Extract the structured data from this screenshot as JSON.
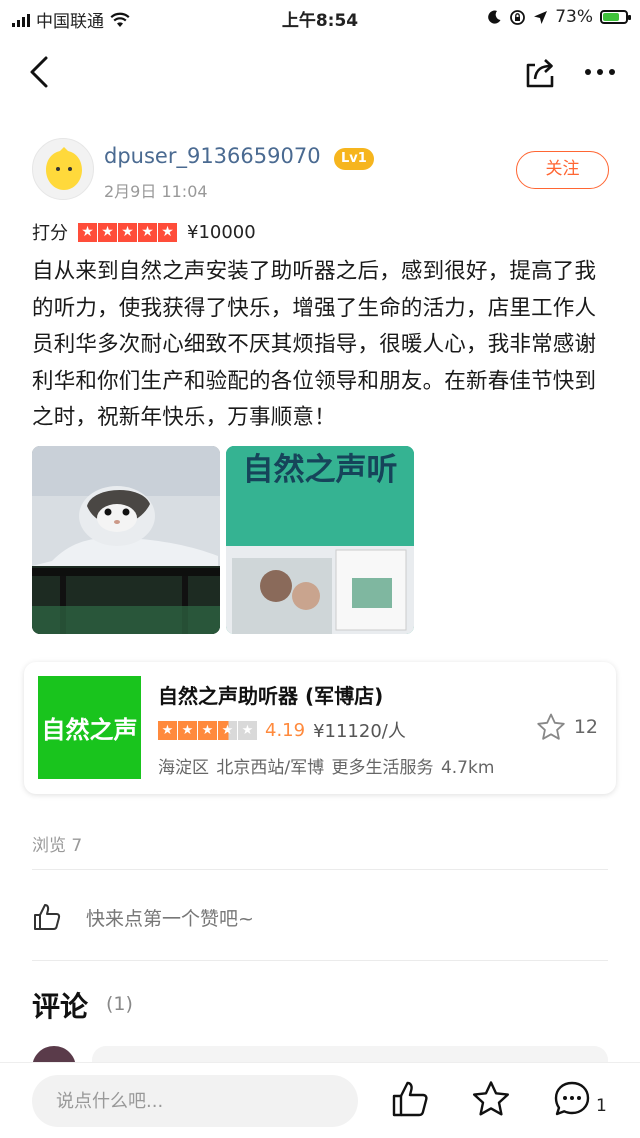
{
  "status_bar": {
    "carrier": "中国联通",
    "time": "上午8:54",
    "battery": "73%",
    "battery_level": 0.73
  },
  "author": {
    "username": "dpuser_9136659070",
    "level": "Lv1",
    "post_time": "2月9日  11:04",
    "follow_label": "关注"
  },
  "rating": {
    "label": "打分",
    "stars": 5,
    "price": "¥10000"
  },
  "review_text": "自从来到自然之声安装了助听器之后，感到很好，提高了我的听力，使我获得了快乐，增强了生命的活力，店里工作人员利华多次耐心细致不厌其烦指导，很暖人心，我非常感谢利华和你们生产和验配的各位领导和朋友。在新春佳节快到之时，祝新年快乐，万事顺意！",
  "photos": {
    "photo2_sign": "自然之声听"
  },
  "shop": {
    "logo_text": "自然之声",
    "name": "自然之声助听器 (军博店)",
    "stars": 4.19,
    "score": "4.19",
    "price": "¥11120/人",
    "fav_count": "12",
    "meta": "海淀区 北京西站/军博 更多生活服务   4.7km"
  },
  "views": "浏览 7",
  "like_prompt": "快来点第一个赞吧~",
  "comments": {
    "title": "评论",
    "count": "(1)"
  },
  "bottom_bar": {
    "input_placeholder": "说点什么吧...",
    "comment_count": "1"
  },
  "colors": {
    "accent": "#ff6633",
    "rating_red": "#ff4d3a",
    "rating_orange": "#ff8a3d",
    "shop_green": "#19c41d",
    "username_blue": "#4a6a91",
    "level_badge": "#f6b51e"
  }
}
